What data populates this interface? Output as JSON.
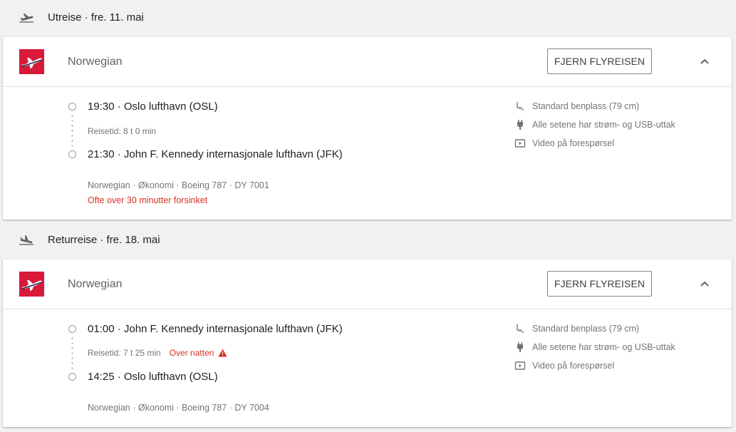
{
  "outbound": {
    "header": "Utreise · fre. 11. mai",
    "airline": "Norwegian",
    "remove_label": "FJERN FLYREISEN",
    "departure": "19:30 · Oslo lufthavn (OSL)",
    "duration": "Reisetid: 8 t 0 min",
    "arrival": "21:30 · John F. Kennedy internasjonale lufthavn (JFK)",
    "details": "Norwegian · Økonomi · Boeing 787 · DY 7001",
    "delay": "Ofte over 30 minutter forsinket",
    "amenities": [
      "Standard benplass (79 cm)",
      "Alle setene har strøm- og USB-uttak",
      "Video på forespørsel"
    ]
  },
  "return": {
    "header": "Returreise · fre. 18. mai",
    "airline": "Norwegian",
    "remove_label": "FJERN FLYREISEN",
    "departure": "01:00 · John F. Kennedy internasjonale lufthavn (JFK)",
    "duration": "Reisetid: 7 t 25 min",
    "overnight": "Over natten",
    "arrival": "14:25 · Oslo lufthavn (OSL)",
    "details": "Norwegian · Økonomi · Boeing 787 · DY 7004",
    "amenities": [
      "Standard benplass (79 cm)",
      "Alle setene har strøm- og USB-uttak",
      "Video på forespørsel"
    ]
  },
  "colors": {
    "brand": "#d81939",
    "warning": "#d93025",
    "muted": "#70757a"
  },
  "icons": [
    "takeoff-icon",
    "landing-icon",
    "airline-logo",
    "chevron-up-icon",
    "seat-icon",
    "power-plug-icon",
    "video-icon",
    "warning-icon"
  ]
}
